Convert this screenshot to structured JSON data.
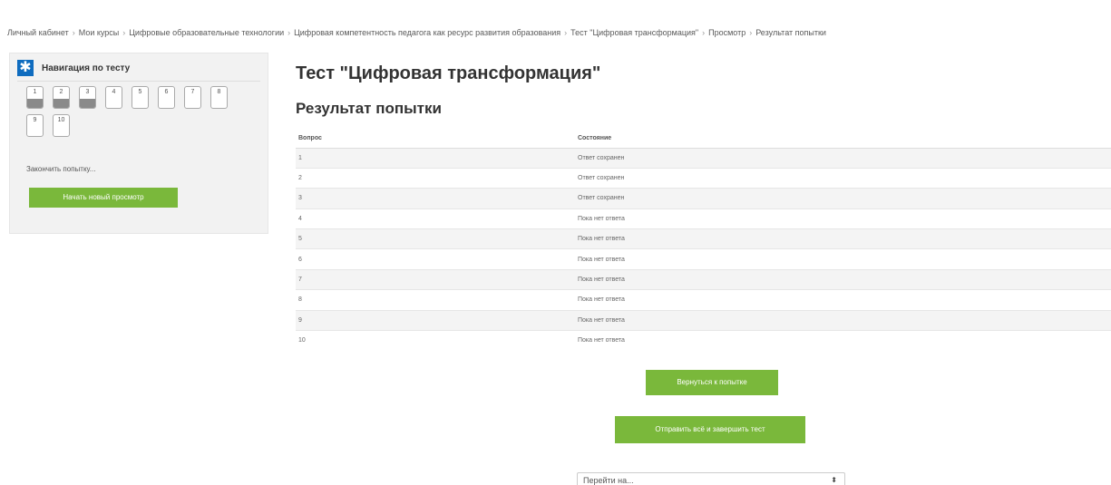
{
  "breadcrumb": [
    "Личный кабинет",
    "Мои курсы",
    "Цифровые образовательные технологии",
    "Цифровая компетентность педагога как ресурс развития образования",
    "Тест \"Цифровая трансформация\"",
    "Просмотр",
    "Результат попытки"
  ],
  "navigation": {
    "title": "Навигация по тесту",
    "logo_glyph": "✱",
    "questions": [
      {
        "number": "1",
        "answered": true
      },
      {
        "number": "2",
        "answered": true
      },
      {
        "number": "3",
        "answered": true
      },
      {
        "number": "4",
        "answered": false
      },
      {
        "number": "5",
        "answered": false
      },
      {
        "number": "6",
        "answered": false
      },
      {
        "number": "7",
        "answered": false
      },
      {
        "number": "8",
        "answered": false
      },
      {
        "number": "9",
        "answered": false
      },
      {
        "number": "10",
        "answered": false
      }
    ],
    "finish_link": "Закончить попытку...",
    "new_preview_button": "Начать новый просмотр"
  },
  "main": {
    "title": "Тест \"Цифровая трансформация\"",
    "subtitle": "Результат попытки",
    "table": {
      "headers": [
        "Вопрос",
        "Состояние"
      ],
      "rows": [
        [
          "1",
          "Ответ сохранен"
        ],
        [
          "2",
          "Ответ сохранен"
        ],
        [
          "3",
          "Ответ сохранен"
        ],
        [
          "4",
          "Пока нет ответа"
        ],
        [
          "5",
          "Пока нет ответа"
        ],
        [
          "6",
          "Пока нет ответа"
        ],
        [
          "7",
          "Пока нет ответа"
        ],
        [
          "8",
          "Пока нет ответа"
        ],
        [
          "9",
          "Пока нет ответа"
        ],
        [
          "10",
          "Пока нет ответа"
        ]
      ]
    },
    "return_button": "Вернуться к попытке",
    "submit_button": "Отправить всё и завершить тест",
    "jump_select": "Перейти на...",
    "jump_arrow": "⬍"
  },
  "colors": {
    "accent": "#7ab83b",
    "logo": "#0f6cbf",
    "answered_fill": "#8a8a8a"
  }
}
